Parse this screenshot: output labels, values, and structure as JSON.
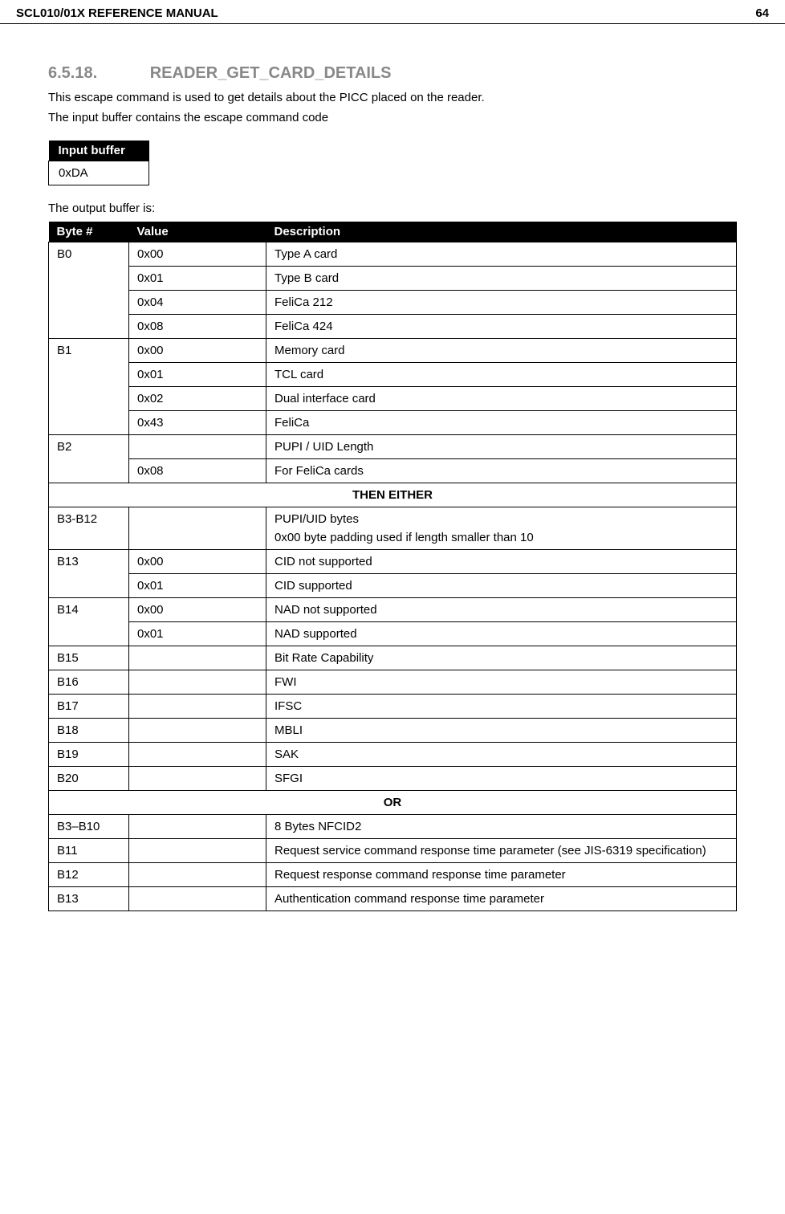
{
  "header": {
    "title_left": "SCL010/01X REFERENCE MANUAL",
    "page_num": "64"
  },
  "section": {
    "number": "6.5.18.",
    "title": "READER_GET_CARD_DETAILS"
  },
  "intro": {
    "line1": "This escape command is used to get details about the PICC placed on the reader.",
    "line2": "The input buffer contains the escape command code"
  },
  "input_table": {
    "header": "Input buffer",
    "value": "0xDA"
  },
  "output_intro": "The output buffer is:",
  "output_headers": {
    "byte": "Byte #",
    "value": "Value",
    "desc": "Description"
  },
  "rows": {
    "b0": {
      "byte": "B0",
      "r1_val": "0x00",
      "r1_desc": "Type A card",
      "r2_val": "0x01",
      "r2_desc": "Type B card",
      "r3_val": "0x04",
      "r3_desc": "FeliCa 212",
      "r4_val": "0x08",
      "r4_desc": "FeliCa 424"
    },
    "b1": {
      "byte": "B1",
      "r1_val": "0x00",
      "r1_desc": "Memory card",
      "r2_val": "0x01",
      "r2_desc": "TCL card",
      "r3_val": "0x02",
      "r3_desc": "Dual interface card",
      "r4_val": "0x43",
      "r4_desc": "FeliCa"
    },
    "b2": {
      "byte": "B2",
      "r1_val": "",
      "r1_desc": "PUPI / UID Length",
      "r2_val": "0x08",
      "r2_desc": "For FeliCa cards"
    },
    "then_either": "THEN EITHER",
    "b3_12": {
      "byte": "B3-B12",
      "val": "",
      "desc1": "PUPI/UID bytes",
      "desc2": "0x00 byte padding used if length smaller than 10"
    },
    "b13": {
      "byte": "B13",
      "r1_val": "0x00",
      "r1_desc": "CID not supported",
      "r2_val": "0x01",
      "r2_desc": "CID supported"
    },
    "b14": {
      "byte": "B14",
      "r1_val": "0x00",
      "r1_desc": "NAD not supported",
      "r2_val": "0x01",
      "r2_desc": "NAD supported"
    },
    "b15": {
      "byte": "B15",
      "val": "",
      "desc": "Bit Rate Capability"
    },
    "b16": {
      "byte": "B16",
      "val": "",
      "desc": "FWI"
    },
    "b17": {
      "byte": "B17",
      "val": "",
      "desc": "IFSC"
    },
    "b18": {
      "byte": "B18",
      "val": "",
      "desc": "MBLI"
    },
    "b19": {
      "byte": "B19",
      "val": "",
      "desc": "SAK"
    },
    "b20": {
      "byte": "B20",
      "val": "",
      "desc": "SFGI"
    },
    "or": "OR",
    "b3_10": {
      "byte": "B3–B10",
      "val": "",
      "desc": "8 Bytes NFCID2"
    },
    "b11": {
      "byte": "B11",
      "val": "",
      "desc": "Request service command response time parameter (see JIS-6319 specification)"
    },
    "b12": {
      "byte": "B12",
      "val": "",
      "desc": "Request response command response time parameter"
    },
    "b13b": {
      "byte": "B13",
      "val": "",
      "desc": "Authentication command response time parameter"
    }
  }
}
